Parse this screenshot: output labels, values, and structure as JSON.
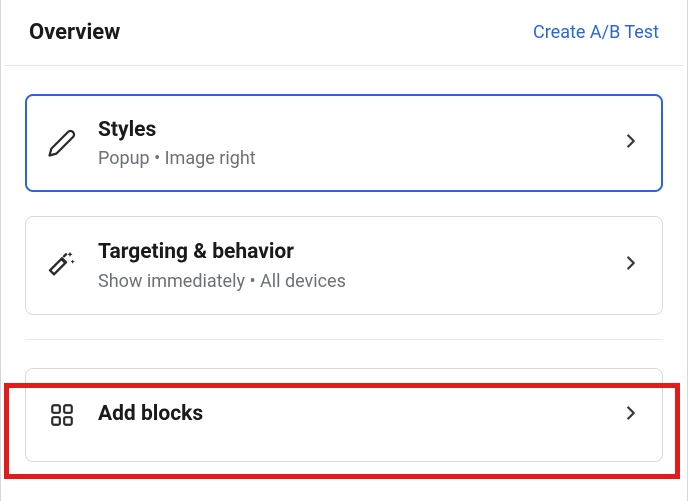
{
  "header": {
    "title": "Overview",
    "ab_link": "Create A/B Test"
  },
  "cards": {
    "styles": {
      "title": "Styles",
      "subtitle": "Popup • Image right"
    },
    "targeting": {
      "title": "Targeting & behavior",
      "subtitle": "Show immediately • All devices"
    },
    "add_blocks": {
      "title": "Add blocks"
    }
  }
}
